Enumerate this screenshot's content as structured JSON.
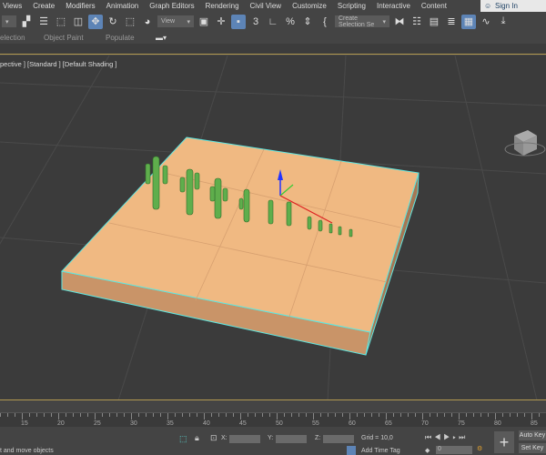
{
  "menu": [
    "Views",
    "Create",
    "Modifiers",
    "Animation",
    "Graph Editors",
    "Rendering",
    "Civil View",
    "Customize",
    "Scripting",
    "Interactive",
    "Content"
  ],
  "sign_in": "Sign In",
  "toolbar": {
    "view_dropdown": "View",
    "selection_set": "Create Selection Se"
  },
  "ribbon": [
    "election",
    "Object Paint",
    "Populate"
  ],
  "viewport": {
    "label": "pective ] [Standard ] [Default Shading ]"
  },
  "timeline": {
    "ticks": [
      "15",
      "20",
      "25",
      "30",
      "35",
      "40",
      "45",
      "50",
      "55",
      "60",
      "65",
      "70",
      "75",
      "80",
      "85"
    ]
  },
  "status": {
    "prompt": "t and move objects",
    "x_label": "X:",
    "y_label": "Y:",
    "z_label": "Z:",
    "grid": "Grid = 10,0",
    "add_time_tag": "Add Time Tag",
    "frame": "0",
    "auto_key": "Auto Key",
    "set_key": "Set Key"
  },
  "colors": {
    "accent": "#5d84b6",
    "selection": "#5ee6e0",
    "platform": "#f0b982",
    "cactus": "#5fae4c"
  }
}
